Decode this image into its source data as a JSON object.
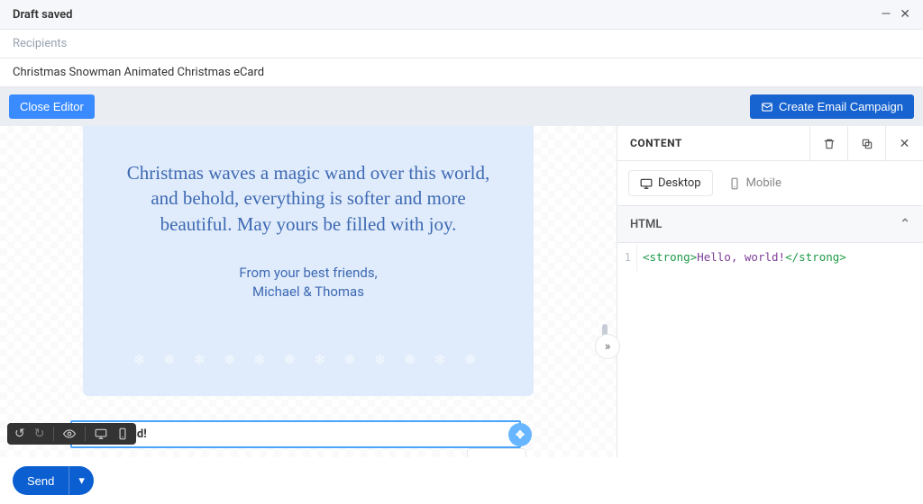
{
  "header": {
    "status": "Draft saved"
  },
  "compose": {
    "recipients_placeholder": "Recipients",
    "subject": "Christmas Snowman Animated Christmas eCard"
  },
  "toolbar": {
    "close_label": "Close Editor",
    "create_label": "Create Email Campaign"
  },
  "card": {
    "quote": "Christmas waves a magic wand over this world, and behold, everything is softer and more beautiful. May yours be filled with joy.",
    "from_line1": "From your best friends,",
    "from_line2": "Michael & Thomas"
  },
  "selected_block": {
    "text": "Hello, world!"
  },
  "right_panel": {
    "title": "CONTENT",
    "tabs": {
      "desktop": "Desktop",
      "mobile": "Mobile"
    },
    "section": "HTML",
    "code": {
      "line_no": "1",
      "open_tag": "<strong>",
      "text": "Hello, world!",
      "close_tag": "</strong>"
    }
  },
  "footer": {
    "send_label": "Send"
  }
}
